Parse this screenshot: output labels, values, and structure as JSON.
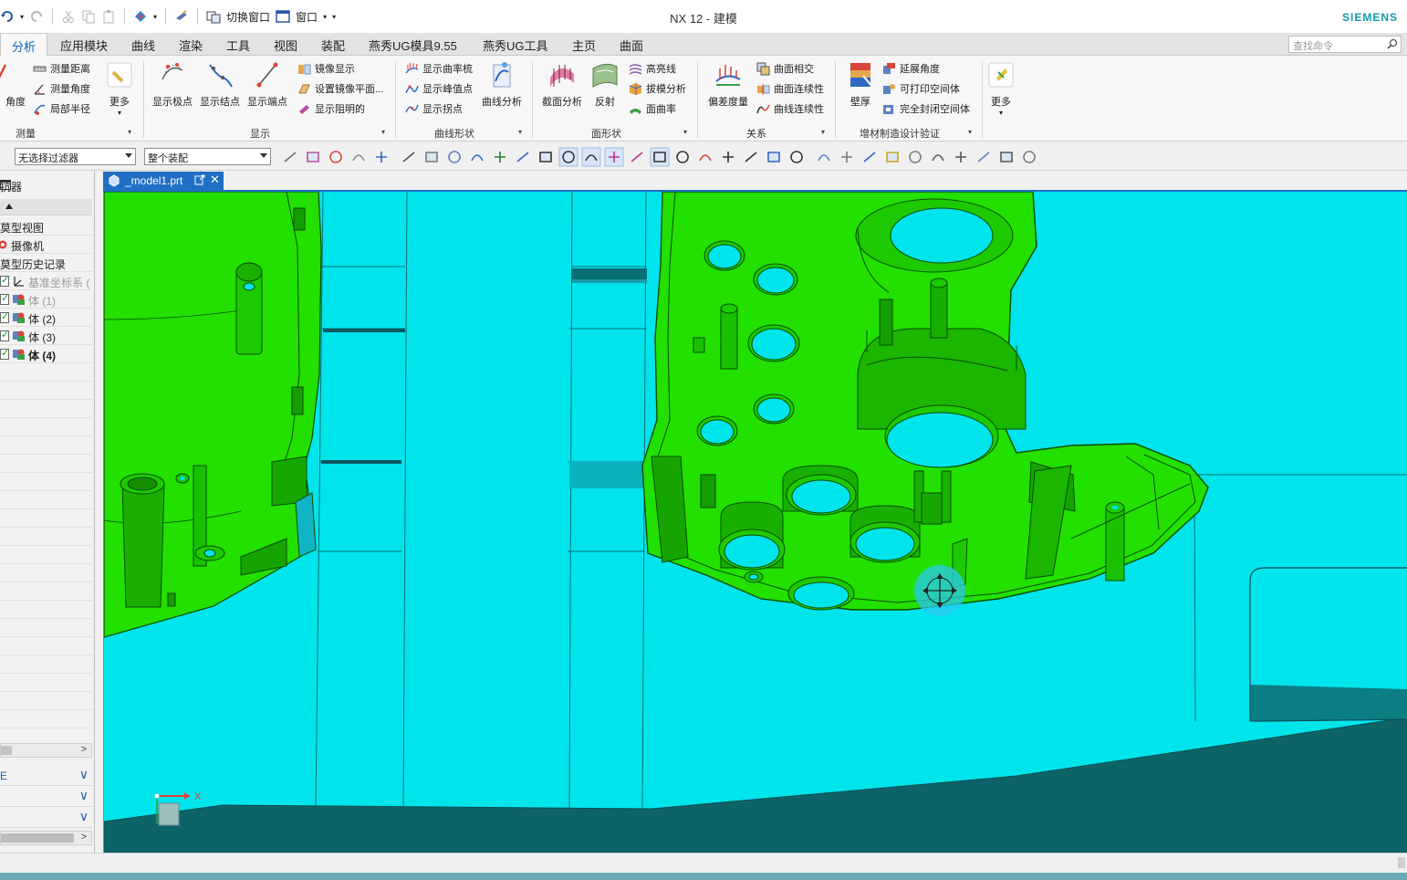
{
  "window": {
    "title": "NX 12 - 建模",
    "brand": "SIEMENS"
  },
  "quick_access": {
    "switch_window_label": "切换窗口",
    "window_menu_label": "窗口"
  },
  "ribbon_tabs": [
    {
      "label": "分析",
      "active": true
    },
    {
      "label": "应用模块"
    },
    {
      "label": "曲线"
    },
    {
      "label": "渲染"
    },
    {
      "label": "工具"
    },
    {
      "label": "视图"
    },
    {
      "label": "装配"
    },
    {
      "label": "燕秀UG模具9.55"
    },
    {
      "label": "燕秀UG工具"
    },
    {
      "label": "主页"
    },
    {
      "label": "曲面"
    }
  ],
  "command_search": {
    "placeholder": "查找命令"
  },
  "ribbon": {
    "measure": {
      "group_label": "测量",
      "big_partial_label": "角度",
      "items": [
        "测量距离",
        "测量角度",
        "局部半径"
      ],
      "more_label": "更多"
    },
    "display": {
      "group_label": "显示",
      "big_items": [
        "显示极点",
        "显示结点",
        "显示端点"
      ],
      "items": [
        "镜像显示",
        "设置镜像平面...",
        "显示阻明的"
      ]
    },
    "curve_shape": {
      "group_label": "曲线形状",
      "items": [
        "显示曲率梳",
        "显示峰值点",
        "显示拐点"
      ],
      "big_label": "曲线分析"
    },
    "face_shape": {
      "group_label": "面形状",
      "big_items": [
        "截面分析",
        "反射"
      ],
      "items": [
        "高亮线",
        "拔模分析",
        "面曲率"
      ]
    },
    "relation": {
      "group_label": "关系",
      "big_label": "偏差度量",
      "items": [
        "曲面相交",
        "曲面连续性",
        "曲线连续性"
      ]
    },
    "additive": {
      "group_label": "增材制造设计验证",
      "big_label": "壁厚",
      "items": [
        "延展角度",
        "可打印空间体",
        "完全封闭空间体"
      ]
    },
    "more_label": "更多"
  },
  "selection_bar": {
    "filter_value": "无选择过滤器",
    "scope_value": "整个装配"
  },
  "navigator": {
    "title": "抗器",
    "rows": [
      {
        "label": "莫型视图",
        "style": "plain"
      },
      {
        "label": "摄像机",
        "style": "camera"
      },
      {
        "label": "莫型历史记录",
        "style": "plain"
      },
      {
        "label": "基准坐标系 (",
        "style": "datum"
      },
      {
        "label": "体 (1)",
        "style": "greyed"
      },
      {
        "label": "体 (2)",
        "style": "body"
      },
      {
        "label": "体 (3)",
        "style": "body"
      },
      {
        "label": "体 (4)",
        "style": "current"
      }
    ],
    "panels": [
      "E",
      "",
      ""
    ]
  },
  "document_tab": {
    "name": "_model1.prt"
  },
  "viewport": {
    "background": "#00e4ec",
    "part_color": "#22e000",
    "floor_color": "#0d6468",
    "triad_x_label": "X"
  }
}
